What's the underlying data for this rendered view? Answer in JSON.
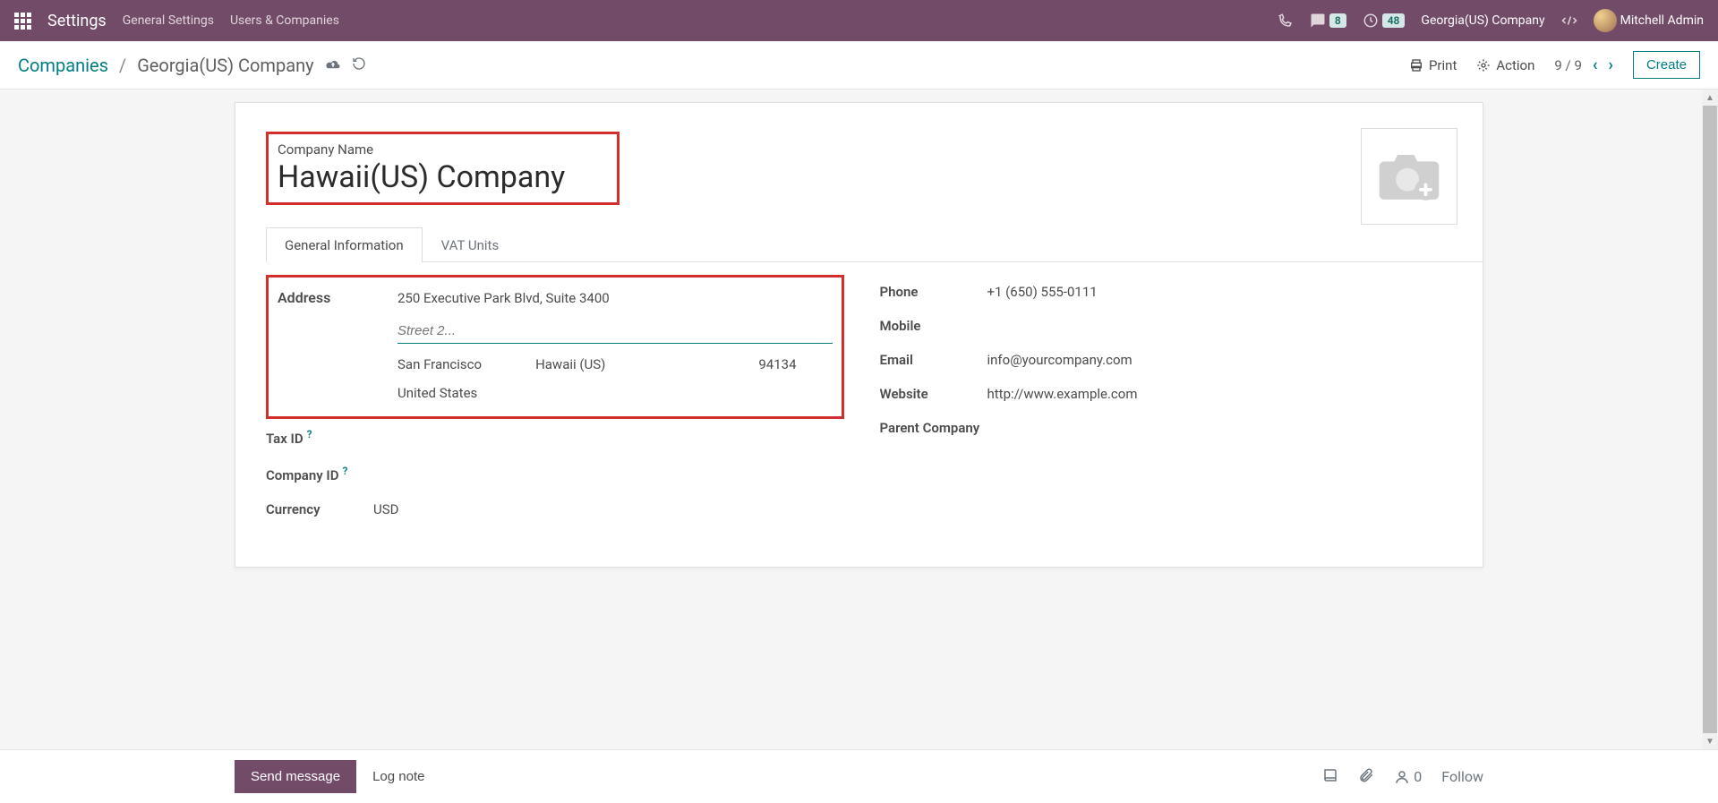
{
  "navbar": {
    "title": "Settings",
    "links": [
      "General Settings",
      "Users & Companies"
    ],
    "msg_count": "8",
    "clock_count": "48",
    "company": "Georgia(US) Company",
    "user": "Mitchell Admin"
  },
  "toolbar": {
    "crumb_root": "Companies",
    "crumb_current": "Georgia(US) Company",
    "print": "Print",
    "action": "Action",
    "pager": "9 / 9",
    "create": "Create"
  },
  "form": {
    "name_label": "Company Name",
    "name_value": "Hawaii(US) Company",
    "tabs": [
      "General Information",
      "VAT Units"
    ],
    "left": {
      "address_label": "Address",
      "street1": "250 Executive Park Blvd, Suite 3400",
      "street2_placeholder": "Street 2...",
      "city": "San Francisco",
      "state": "Hawaii (US)",
      "zip": "94134",
      "country": "United States",
      "taxid_label": "Tax ID",
      "companyid_label": "Company ID",
      "currency_label": "Currency",
      "currency_value": "USD"
    },
    "right": {
      "phone_label": "Phone",
      "phone_value": "+1 (650) 555-0111",
      "mobile_label": "Mobile",
      "email_label": "Email",
      "email_value": "info@yourcompany.com",
      "website_label": "Website",
      "website_value": "http://www.example.com",
      "parent_label": "Parent Company"
    }
  },
  "chatter": {
    "send": "Send message",
    "lognote": "Log note",
    "follower_count": "0",
    "follow": "Follow"
  }
}
